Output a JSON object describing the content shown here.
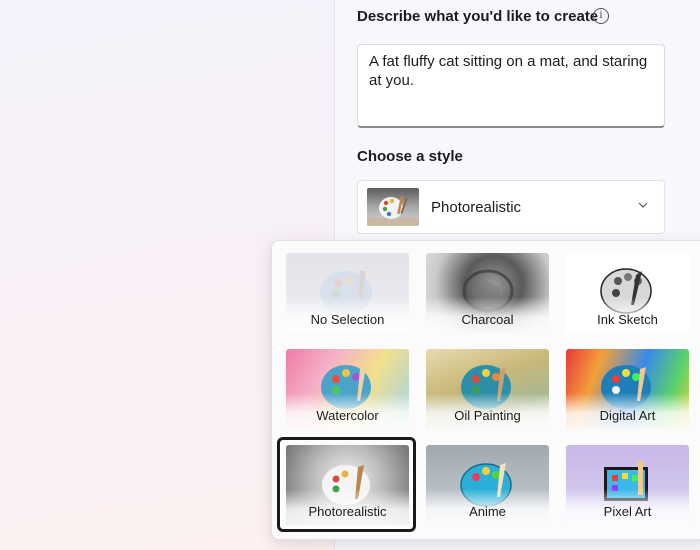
{
  "prompt": {
    "label": "Describe what you'd like to create",
    "value": "A fat fluffy cat sitting on a mat, and staring at you."
  },
  "style": {
    "label": "Choose a style",
    "selected": "Photorealistic"
  },
  "styles": [
    {
      "name": "No Selection"
    },
    {
      "name": "Charcoal"
    },
    {
      "name": "Ink Sketch"
    },
    {
      "name": "Watercolor"
    },
    {
      "name": "Oil Painting"
    },
    {
      "name": "Digital Art"
    },
    {
      "name": "Photorealistic"
    },
    {
      "name": "Anime"
    },
    {
      "name": "Pixel Art"
    }
  ],
  "icons": {
    "info": "info-icon",
    "chevron": "chevron-down-icon",
    "palette": "palette-icon"
  },
  "colors": {
    "selection_ring": "#1a1a1a",
    "panel_bg": "#f9f7fc"
  }
}
